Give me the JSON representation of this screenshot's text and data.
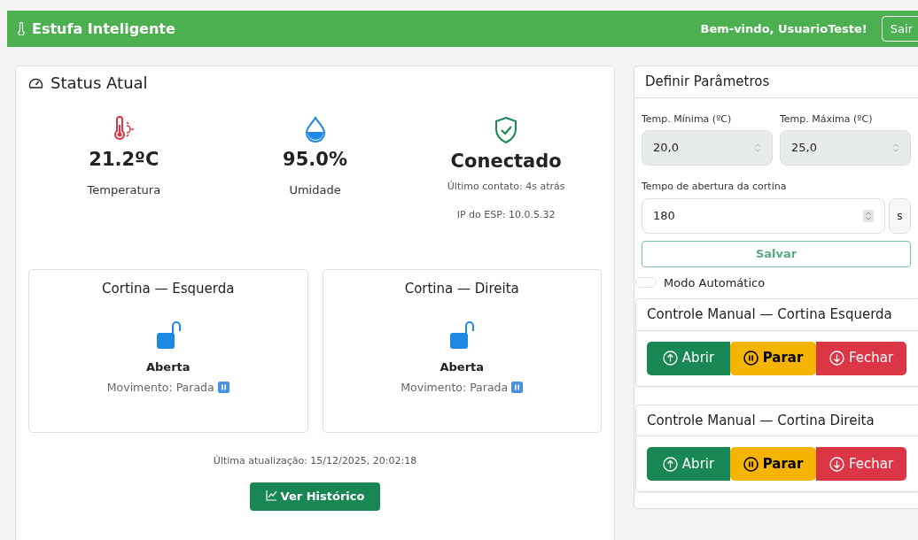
{
  "navbar": {
    "brand": "Estufa Inteligente",
    "welcome": "Bem-vindo, UsuarioTeste!",
    "logout": "Sair"
  },
  "status": {
    "title": "Status Atual",
    "metrics": [
      {
        "kind": "temperature",
        "value": "21.2ºC",
        "label": "Temperatura"
      },
      {
        "kind": "humidity",
        "value": "95.0%",
        "label": "Umidade"
      },
      {
        "kind": "connection",
        "value": "Conectado",
        "lines": [
          "Último contato: 4s atrás",
          "IP do ESP: 10.0.5.32"
        ]
      }
    ],
    "curtains": [
      {
        "title": "Cortina — Esquerda",
        "state": "Aberta",
        "movement": "Movimento: Parada"
      },
      {
        "title": "Cortina — Direita",
        "state": "Aberta",
        "movement": "Movimento: Parada"
      }
    ],
    "updated": "Última atualização: 15/12/2025, 20:02:18",
    "history_button": "Ver Histórico"
  },
  "parameters": {
    "title": "Definir Parâmetros",
    "fields": [
      {
        "label": "Temp. Mínima (ºC)",
        "value": "20,0",
        "disabled": true
      },
      {
        "label": "Temp. Máxima (ºC)",
        "value": "25,0",
        "disabled": true
      }
    ],
    "duration": {
      "label": "Tempo de abertura da cortina",
      "value": "180",
      "unit": "s"
    },
    "save": "Salvar",
    "auto_mode": {
      "label": "Modo Automático",
      "on": false
    }
  },
  "manual": [
    {
      "title": "Controle Manual — Cortina Esquerda",
      "buttons": [
        {
          "kind": "open",
          "label": "Abrir"
        },
        {
          "kind": "stop",
          "label": "Parar"
        },
        {
          "kind": "close",
          "label": "Fechar"
        }
      ]
    },
    {
      "title": "Controle Manual — Cortina Direita",
      "buttons": [
        {
          "kind": "open",
          "label": "Abrir"
        },
        {
          "kind": "stop",
          "label": "Parar"
        },
        {
          "kind": "close",
          "label": "Fechar"
        }
      ]
    }
  ]
}
